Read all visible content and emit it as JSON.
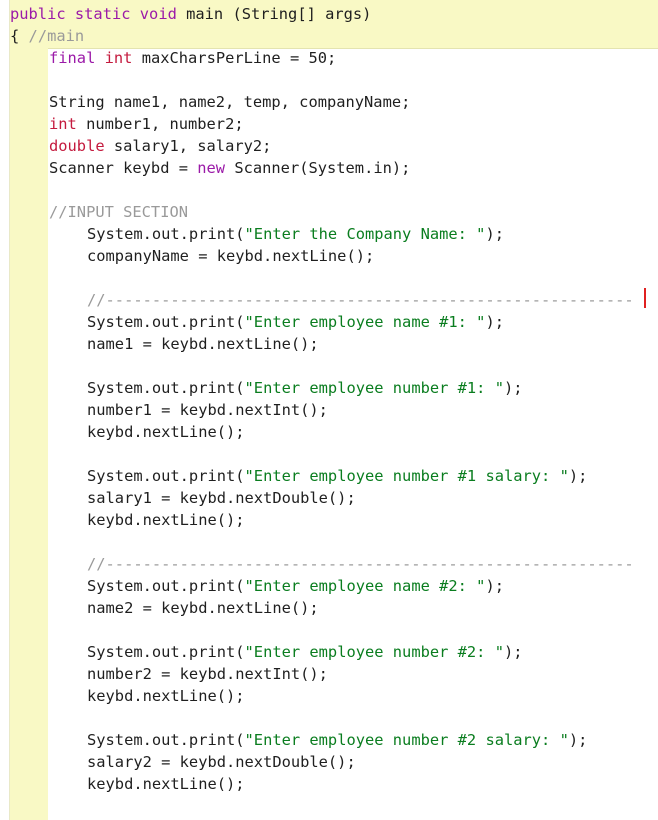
{
  "lines": [
    "public static void main (String[] args)",
    "{ //main",
    "final int maxCharsPerLine = 50;",
    "",
    "String name1, name2, temp, companyName;",
    "int number1, number2;",
    "double salary1, salary2;",
    "Scanner keybd = new Scanner(System.in);",
    "",
    "//INPUT SECTION",
    "System.out.print(\"Enter the Company Name: \");",
    "companyName = keybd.nextLine();",
    "",
    "//---------------------------------------------------------",
    "System.out.print(\"Enter employee name #1: \");",
    "name1 = keybd.nextLine();",
    "",
    "System.out.print(\"Enter employee number #1: \");",
    "number1 = keybd.nextInt();",
    "keybd.nextLine();",
    "",
    "System.out.print(\"Enter employee number #1 salary: \");",
    "salary1 = keybd.nextDouble();",
    "keybd.nextLine();",
    "",
    "//---------------------------------------------------------",
    "System.out.print(\"Enter employee name #2: \");",
    "name2 = keybd.nextLine();",
    "",
    "System.out.print(\"Enter employee number #2: \");",
    "number2 = keybd.nextInt();",
    "keybd.nextLine();",
    "",
    "System.out.print(\"Enter employee number #2 salary: \");",
    "salary2 = keybd.nextDouble();",
    "keybd.nextLine();"
  ],
  "colors": {
    "keyword": "#9b1aa8",
    "type": "#c41a3e",
    "string": "#0a7d1f",
    "comment": "#9a9a9a",
    "highlight": "#f9f9c5",
    "caret": "#e02020"
  }
}
